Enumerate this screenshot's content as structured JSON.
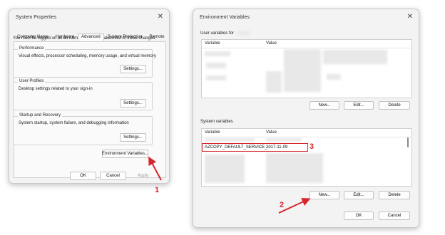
{
  "sys_props": {
    "title": "System Properties",
    "tabs": [
      "Computer Name",
      "Hardware",
      "Advanced",
      "System Protection",
      "Remote"
    ],
    "active_tab": "Advanced",
    "admin_note": "You must be logged on as an Administrator to make most of these changes.",
    "performance": {
      "title": "Performance",
      "desc": "Visual effects, processor scheduling, memory usage, and virtual memory",
      "button": "Settings..."
    },
    "user_profiles": {
      "title": "User Profiles",
      "desc": "Desktop settings related to your sign-in",
      "button": "Settings..."
    },
    "startup": {
      "title": "Startup and Recovery",
      "desc": "System startup, system failure, and debugging information",
      "button": "Settings..."
    },
    "env_button": "Environment Variables...",
    "ok": "OK",
    "cancel": "Cancel",
    "apply": "Apply"
  },
  "env_vars": {
    "title": "Environment Variables",
    "user_section": "User variables for",
    "col_variable": "Variable",
    "col_value": "Value",
    "user_buttons": {
      "new": "New...",
      "edit": "Edit...",
      "delete": "Delete"
    },
    "system_section": "System variables",
    "selected_row": {
      "variable": "AZCOPY_DEFAULT_SERVICE_...",
      "value": "2017-11-09"
    },
    "system_buttons": {
      "new": "New...",
      "edit": "Edit...",
      "delete": "Delete"
    },
    "ok": "OK",
    "cancel": "Cancel"
  },
  "annotations": {
    "step1": "1",
    "step2": "2",
    "step3": "3",
    "color": "#d7262c"
  },
  "icons": {
    "close": "close-icon",
    "arrow": "arrow-icon"
  }
}
